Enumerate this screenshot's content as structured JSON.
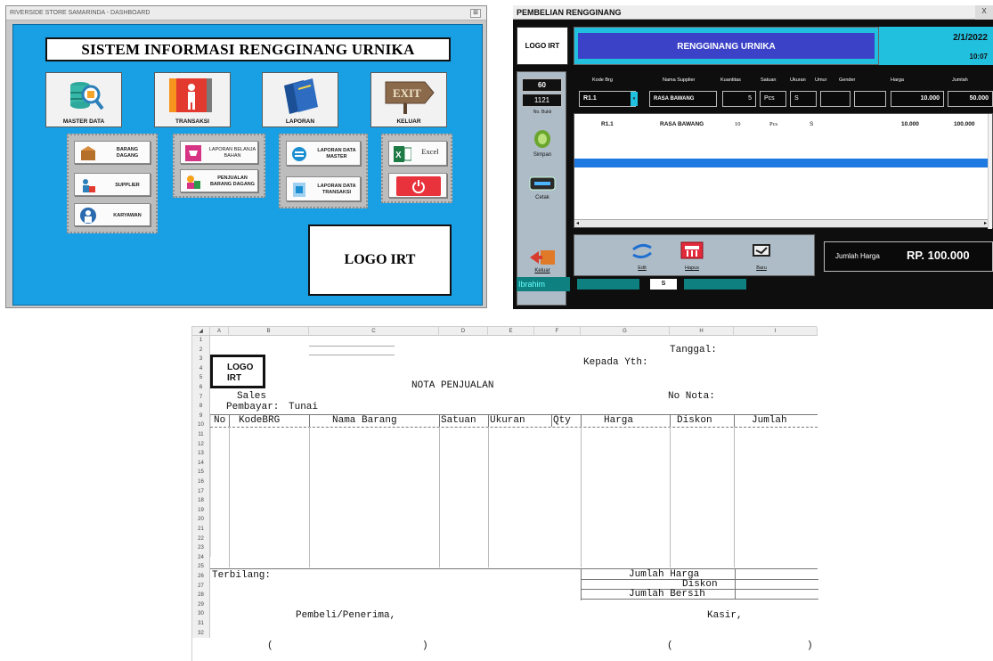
{
  "dashboard": {
    "window_title": "RIVERSIDE STORE SAMARINDA - DASHBOARD",
    "close_glyph": "⊠",
    "system_title": "SISTEM INFORMASI RENGGINANG URNIKA",
    "main_buttons": [
      {
        "label": "MASTER DATA",
        "icon": "database-search-icon"
      },
      {
        "label": "TRANSAKSI",
        "icon": "person-book-icon"
      },
      {
        "label": "LAPORAN",
        "icon": "books-icon"
      },
      {
        "label": "KELUAR",
        "icon": "exit-sign-icon"
      }
    ],
    "master_items": [
      "BARANG DAGANG",
      "SUPPLIER",
      "KARYAWAN"
    ],
    "transaksi_items": [
      "LAPORAN BELANJA BAHAN",
      "PENJUALAN BARANG DAGANG"
    ],
    "laporan_items": [
      "LAPORAN DATA MASTER",
      "LAPORAN DATA TRANSAKSI"
    ],
    "excel_label": "Excel",
    "logo_text": "LOGO IRT"
  },
  "purchase": {
    "window_title": "PEMBELIAN RENGGINANG",
    "close_glyph": "X",
    "logo_text": "LOGO IRT",
    "header_title": "RENGGINANG URNIKA",
    "date": "2/1/2022",
    "time": "10:07",
    "field_top": "60",
    "field_bukti": "1121",
    "no_bukti_label": "No. Bukti",
    "columns": [
      "Kode Brg",
      "Nama Supplier",
      "Kuantitas",
      "Satuan",
      "Ukuran",
      "Umur",
      "Gender",
      "Harga",
      "Jumlah"
    ],
    "input": {
      "kode": "R1.1",
      "supplier": "RASA BAWANG",
      "qty": "5",
      "satuan": "Pcs",
      "ukuran": "S",
      "harga": "10.000",
      "jumlah": "50.000"
    },
    "row": {
      "kode": "R1.1",
      "supplier": "RASA BAWANG",
      "qty": "10",
      "satuan": "Pcs",
      "ukuran": "S",
      "harga": "10.000",
      "jumlah": "100.000"
    },
    "btn_simpan": "Simpan",
    "btn_cetak": "Cetak",
    "btn_keluar": "Keluar",
    "btn_edit": "Edit",
    "btn_hapus": "Hapus",
    "btn_baru": "Baru",
    "total_label": "Jumlah Harga",
    "total_value": "RP. 100.000",
    "user": "Ibrahim",
    "size_value": "S"
  },
  "sheet": {
    "columns": [
      "A",
      "B",
      "C",
      "D",
      "E",
      "F",
      "G",
      "H",
      "I"
    ],
    "logo_text": "LOGO\nIRT",
    "tanggal": "Tanggal:",
    "kepada": "Kepada Yth:",
    "title": "NOTA PENJUALAN",
    "sales": "Sales",
    "pembayaran_label": "Pembayar:",
    "pembayaran_value": "Tunai",
    "no_nota": "No Nota:",
    "table_headers": [
      "No",
      "KodeBRG",
      "Nama Barang",
      "Satuan",
      "Ukuran",
      "Qty",
      "Harga",
      "Diskon",
      "Jumlah"
    ],
    "terbilang": "Terbilang:",
    "jumlah_harga": "Jumlah Harga",
    "diskon": "Diskon",
    "jumlah_bersih": "Jumlah Bersih",
    "pembeli": "Pembeli/Penerima,",
    "kasir": "Kasir,",
    "paren_open": "(",
    "paren_close": ")"
  }
}
